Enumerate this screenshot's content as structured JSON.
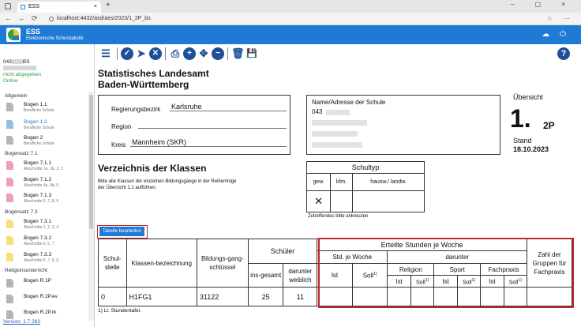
{
  "browser": {
    "tab_title": "ESS",
    "tab_close": "×",
    "new_tab": "+",
    "window_controls": "– ▢ ×",
    "nav": {
      "back": "←",
      "forward": "→",
      "reload": "⟳"
    },
    "url": "localhost:4432/asd/aes/2023/1_2P_bs",
    "toolbar_icons": "☆ ⋯"
  },
  "app": {
    "title": "ESS",
    "subtitle": "Elektronische Schulstatistik",
    "icons": "☁ ⏻"
  },
  "sidebar": {
    "user_code": "043",
    "user_code_suffix": "BS",
    "login_status": "nicht abgegeben",
    "online_status": "Online",
    "sections": [
      {
        "label": "Allgemein"
      },
      {
        "label": "Bogensatz 7.1"
      },
      {
        "label": "Bogensatz 7.3"
      },
      {
        "label": "Religionsunterricht"
      }
    ],
    "items": [
      {
        "title": "Bogen 1.1",
        "sub": "Berufliche Schule"
      },
      {
        "title": "Bogen 1.2",
        "sub": "Berufliche Schule"
      },
      {
        "title": "Bogen 2",
        "sub": "Berufliche Schule"
      },
      {
        "title": "Bogen 7.1.1",
        "sub": "Abschnitte 1a, 1b, 2, 3"
      },
      {
        "title": "Bogen 7.1.2",
        "sub": "Abschnitte 4a, 4b, 5"
      },
      {
        "title": "Bogen 7.1.3",
        "sub": "Abschnitte 6, 7, 8, 9"
      },
      {
        "title": "Bogen 7.3.1",
        "sub": "Abschnitte 1, 2, 3, 4"
      },
      {
        "title": "Bogen 7.3.2",
        "sub": "Abschnitte 5, 6, 7"
      },
      {
        "title": "Bogen 7.3.3",
        "sub": "Abschnitte 6, 7, 8, 9"
      },
      {
        "title": "Bogen R.1P",
        "sub": ""
      },
      {
        "title": "Bogen R.2P.ev",
        "sub": ""
      },
      {
        "title": "Bogen R.2P.rk",
        "sub": ""
      }
    ],
    "version": "Version: 1.7.283"
  },
  "toolbar": {
    "menu": "☰",
    "check": "✓",
    "send": "➤",
    "cancel": "✕",
    "print": "⎙",
    "zoom_in": "+",
    "move": "✥",
    "zoom_out": "−",
    "delete": "🗑",
    "save": "💾",
    "help": "?"
  },
  "form": {
    "authority_line1": "Statistisches Landesamt",
    "authority_line2": "Baden-Württemberg",
    "region_label": "Regierungsbezirk",
    "region_value": "Karlsruhe",
    "subregion_label": "Region",
    "subregion_value": "",
    "district_label": "Kreis",
    "district_value": "Mannheim (SKR)",
    "school_label": "Name/Adresse der Schule",
    "school_code": "043",
    "overview_label": "Übersicht",
    "form_number": "1.",
    "form_suffix": "2P",
    "date_label": "Stand",
    "date_value": "18.10.2023",
    "list_title": "Verzeichnis der Klassen",
    "list_desc_line1": "Bitte alle Klassen der einzelnen Bildungsgänge in der Reihenfolge",
    "list_desc_line2": "der Übersicht 1.1 aufführen.",
    "schultyp_title": "Schultyp",
    "schultyp_cols": [
      "gew.",
      "kfm.",
      "hausw./ landw."
    ],
    "schultyp_mark": "✕",
    "schultyp_hint": "Zutreffendes bitte ankreuzen",
    "edit_button": "Tabelle bearbeiten",
    "footnote": "1) Lt. Stundentafel."
  },
  "table": {
    "col_schulstelle": "Schul-stelle",
    "col_klasse": "Klassen-bezeichnung",
    "col_bildungsgang": "Bildungs-gang-schlüssel",
    "col_schueler": "Schüler",
    "col_insgesamt": "ins-gesamt",
    "col_weiblich": "darunter weiblich",
    "col_stunden": "Erteilte Stunden je Woche",
    "col_std_je_woche": "Std. je Woche",
    "col_darunter": "darunter",
    "col_religion": "Religion",
    "col_sport": "Sport",
    "col_fachpraxis": "Fachpraxis",
    "col_ist": "Ist",
    "col_soll": "Soll",
    "col_soll_sup": "1)",
    "col_gruppen": "Zahl der Gruppen für Fachpraxis",
    "row": {
      "schulstelle": "0",
      "klasse": "H1FG1",
      "schluessel": "31122",
      "insgesamt": "25",
      "weiblich": "11"
    }
  }
}
